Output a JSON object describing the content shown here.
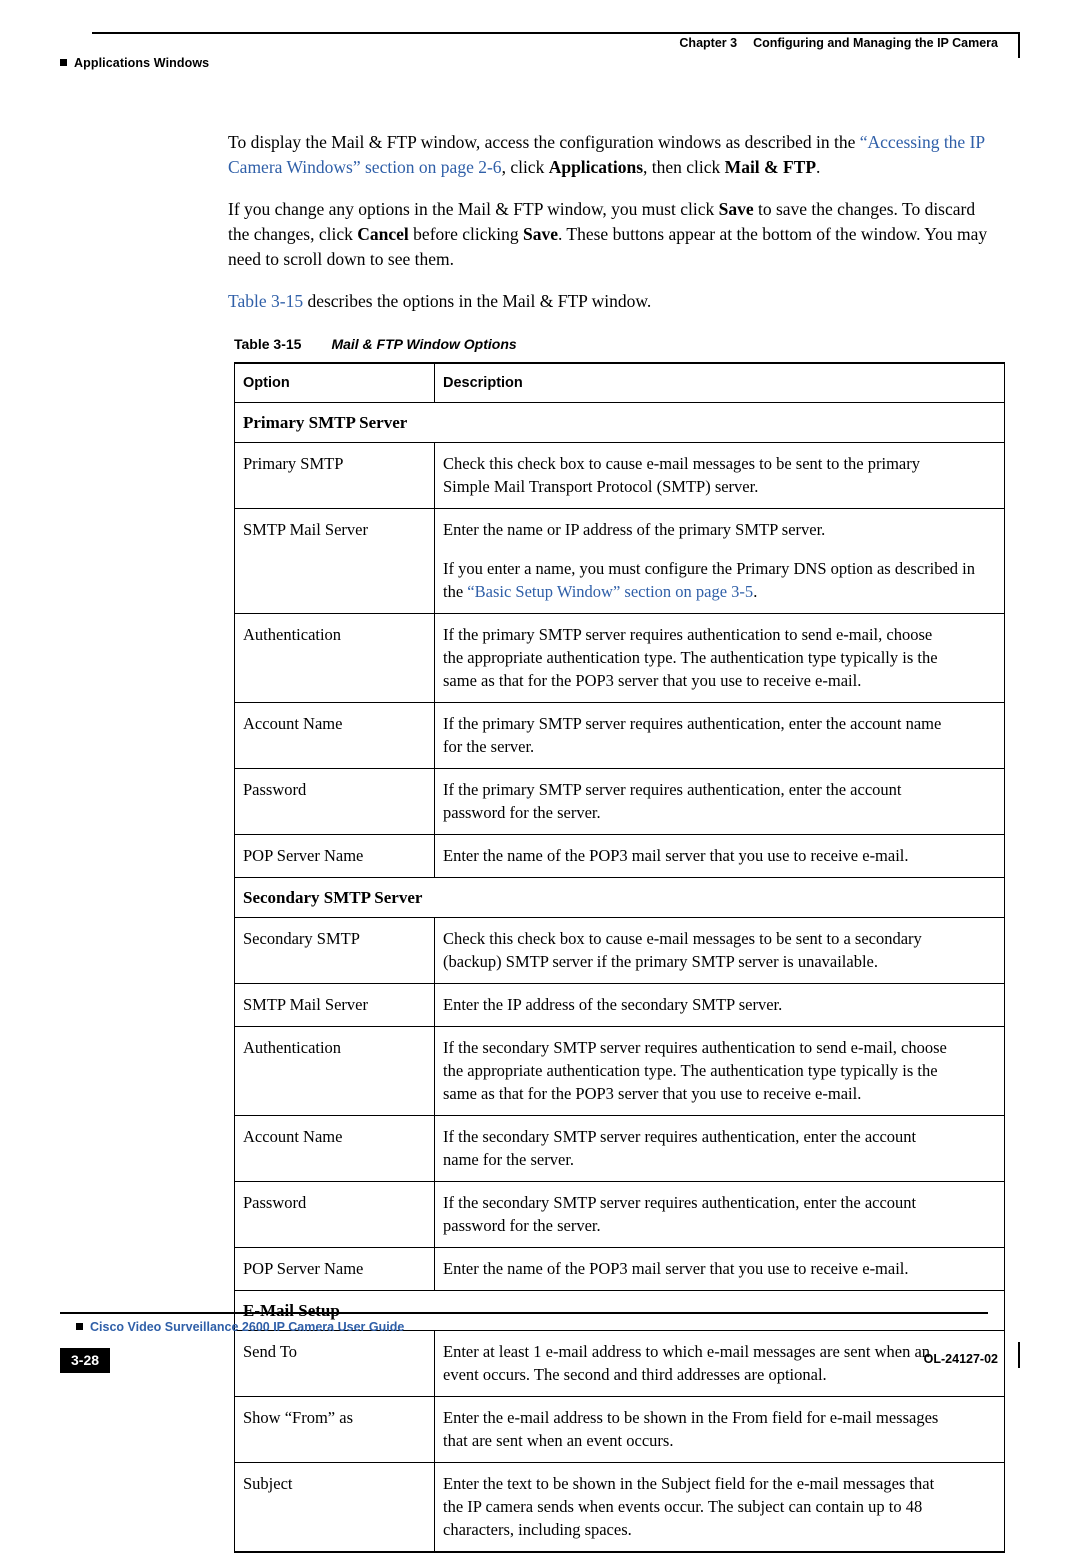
{
  "header": {
    "left_text": "Applications Windows",
    "chapter_label": "Chapter 3",
    "chapter_title": "Configuring and Managing the IP Camera"
  },
  "body": {
    "p1_a": "To display the Mail & FTP window, access the configuration windows as described in the ",
    "p1_link1": "“Accessing the IP Camera Windows” section on page 2-6",
    "p1_b": ", click ",
    "p1_bold1": "Applications",
    "p1_c": ", then click ",
    "p1_bold2": "Mail & FTP",
    "p1_d": ".",
    "p2_a": "If you change any options in the Mail & FTP window, you must click ",
    "p2_bold1": "Save",
    "p2_b": " to save the changes. To discard the changes, click ",
    "p2_bold2": "Cancel",
    "p2_c": " before clicking ",
    "p2_bold3": "Save",
    "p2_d": ". These buttons appear at the bottom of the window. You may need to scroll down to see them.",
    "p3_link": "Table 3-15",
    "p3_text": " describes the options in the Mail & FTP window."
  },
  "table": {
    "caption_num": "Table 3-15",
    "caption_title": "Mail & FTP Window Options",
    "columns": [
      "Option",
      "Description"
    ],
    "rows": [
      {
        "type": "section",
        "label": "Primary SMTP Server"
      },
      {
        "type": "data",
        "option": "Primary SMTP",
        "lines": [
          "Check this check box to cause e-mail messages to be sent to the primary",
          "Simple Mail Transport Protocol (SMTP) server."
        ]
      },
      {
        "type": "data",
        "option": "SMTP Mail Server",
        "lines": [
          "Enter the name or IP address of the primary SMTP server."
        ],
        "para2_a": "If you enter a name, you must configure the Primary DNS option as described in the ",
        "para2_link": "“Basic Setup Window” section on page 3-5",
        "para2_b": "."
      },
      {
        "type": "data",
        "option": "Authentication",
        "lines": [
          "If the primary SMTP server requires authentication to send e-mail, choose",
          "the appropriate authentication type. The authentication type typically is the",
          "same as that for the POP3 server that you use to receive e-mail."
        ]
      },
      {
        "type": "data",
        "option": "Account Name",
        "lines": [
          "If the primary SMTP server requires authentication, enter the account name",
          "for the server."
        ]
      },
      {
        "type": "data",
        "option": "Password",
        "lines": [
          "If the primary SMTP server requires authentication, enter the account",
          "password for the server."
        ]
      },
      {
        "type": "data",
        "option": "POP Server Name",
        "lines": [
          "Enter the name of the POP3 mail server that you use to receive e-mail."
        ]
      },
      {
        "type": "section",
        "label": "Secondary SMTP Server"
      },
      {
        "type": "data",
        "option": "Secondary SMTP",
        "lines": [
          "Check this check box to cause e-mail messages to be sent to a secondary",
          "(backup) SMTP server if the primary SMTP server is unavailable."
        ]
      },
      {
        "type": "data",
        "option": "SMTP Mail Server",
        "lines": [
          "Enter the IP address of the secondary SMTP server."
        ]
      },
      {
        "type": "data",
        "option": "Authentication",
        "lines": [
          "If the secondary SMTP server requires authentication to send e-mail, choose",
          "the appropriate authentication type. The authentication type typically is the",
          "same as that for the POP3 server that you use to receive e-mail."
        ]
      },
      {
        "type": "data",
        "option": "Account Name",
        "lines": [
          "If the secondary SMTP server requires authentication, enter the account",
          "name for the server."
        ]
      },
      {
        "type": "data",
        "option": "Password",
        "lines": [
          "If the secondary SMTP server requires authentication, enter the account",
          "password for the server."
        ]
      },
      {
        "type": "data",
        "option": "POP Server Name",
        "lines": [
          "Enter the name of the POP3 mail server that you use to receive e-mail."
        ]
      },
      {
        "type": "section",
        "label": "E-Mail Setup"
      },
      {
        "type": "data",
        "option": "Send To",
        "lines": [
          "Enter at least 1 e-mail address to which e-mail messages are sent when an",
          "event occurs. The second and third addresses are optional."
        ]
      },
      {
        "type": "data",
        "option": "Show “From” as",
        "lines": [
          "Enter the e-mail address to be shown in the From field for e-mail messages",
          "that are sent when an event occurs."
        ]
      },
      {
        "type": "data",
        "option": "Subject",
        "lines": [
          "Enter the text to be shown in the Subject field for the e-mail messages that",
          "the IP camera sends when events occur. The subject can contain up to 48",
          "characters, including spaces."
        ]
      }
    ]
  },
  "footer": {
    "guide_title": "Cisco Video Surveillance 2600 IP Camera User Guide",
    "page_number": "3-28",
    "doc_number": "OL-24127-02"
  },
  "colors": {
    "link": "#2f5fa8",
    "rule": "#000000"
  }
}
